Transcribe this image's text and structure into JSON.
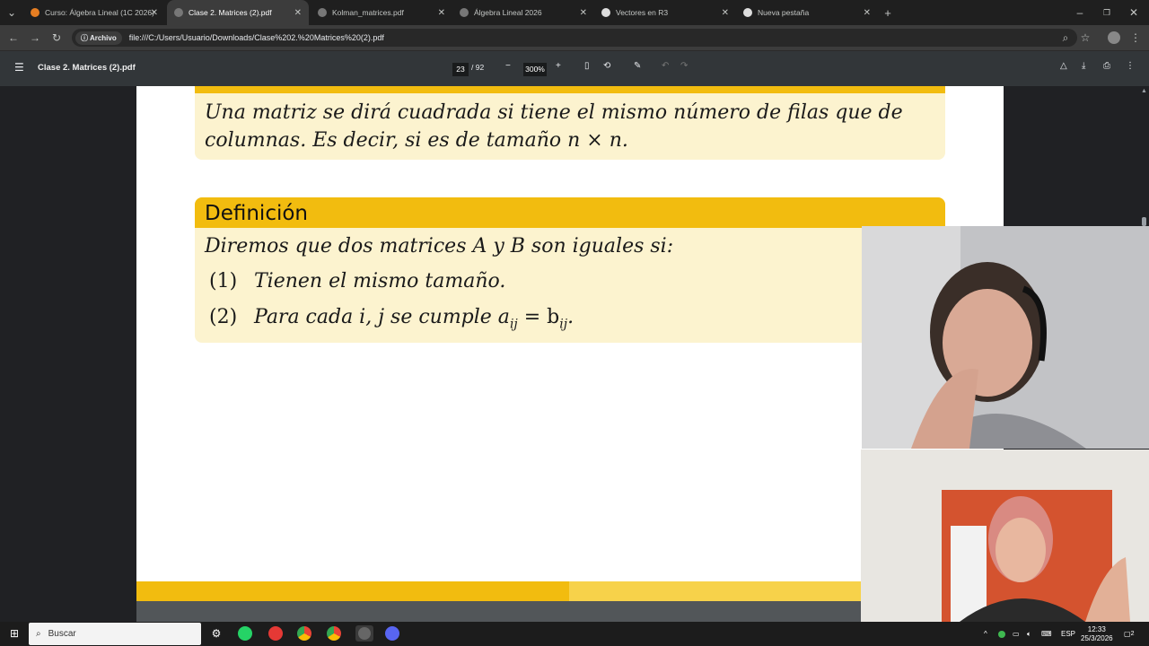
{
  "tabs": [
    {
      "label": "Curso: Álgebra Lineal (1C 2026)",
      "active": false
    },
    {
      "label": "Clase 2. Matrices (2).pdf",
      "active": true
    },
    {
      "label": "Kolman_matrices.pdf",
      "active": false
    },
    {
      "label": "Álgebra Lineal 2026",
      "active": false
    },
    {
      "label": "Vectores en R3",
      "active": false
    },
    {
      "label": "Nueva pestaña",
      "active": false
    }
  ],
  "new_tab": "+",
  "address": {
    "chip": "Archivo",
    "url": "file:///C:/Users/Usuario/Downloads/Clase%202.%20Matrices%20(2).pdf"
  },
  "pdf_toolbar": {
    "title": "Clase 2. Matrices (2).pdf",
    "page": "23",
    "total": "/ 92",
    "zoom": "300%",
    "minus": "−",
    "plus": "+"
  },
  "slide": {
    "top_box_line1": "Una matriz se dirá cuadrada si tiene el mismo número de filas que de",
    "top_box_line2": "columnas. Es decir, si es de tamaño n × n.",
    "def_title": "Definición",
    "def_line": "Diremos que dos matrices A y B son iguales si:",
    "item1_num": "(1)",
    "item1_text": "Tienen el mismo tamaño.",
    "item2_num": "(2)",
    "item2_pre": "Para cada i, j se cumple a",
    "item2_sub1": "ij",
    "item2_eq": " = b",
    "item2_sub2": "ij",
    "item2_end": "."
  },
  "taskbar": {
    "search_placeholder": "Buscar",
    "lang": "ESP",
    "time": "12:33",
    "date": "25/3/2026",
    "notif": "2"
  }
}
